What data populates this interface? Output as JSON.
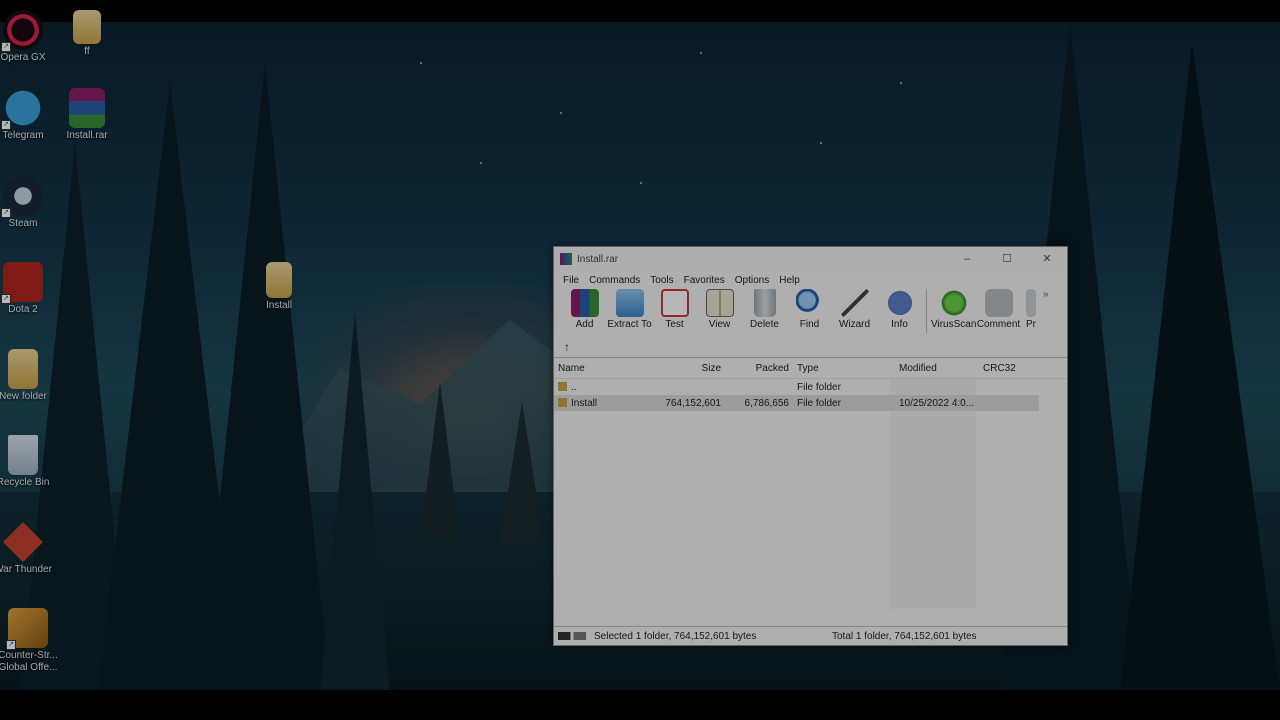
{
  "desktop": {
    "icons": [
      {
        "label": "Opera GX",
        "icon": "opera-gx-icon"
      },
      {
        "label": "ff",
        "icon": "folder-icon"
      },
      {
        "label": "Telegram",
        "icon": "telegram-icon"
      },
      {
        "label": "Install.rar",
        "icon": "winrar-archive-icon"
      },
      {
        "label": "Steam",
        "icon": "steam-icon"
      },
      {
        "label": "Install",
        "icon": "folder-icon"
      },
      {
        "label": "Dota 2",
        "icon": "dota2-icon"
      },
      {
        "label": "New folder",
        "icon": "folder-icon"
      },
      {
        "label": "Recycle Bin",
        "icon": "recycle-bin-icon"
      },
      {
        "label": "War Thunder",
        "icon": "war-thunder-icon"
      },
      {
        "label": "Counter-Str... Global Offe...",
        "icon": "csgo-icon"
      }
    ]
  },
  "window": {
    "title": "Install.rar",
    "controls": {
      "minimize": "–",
      "maximize": "☐",
      "close": "✕"
    },
    "menu": [
      "File",
      "Commands",
      "Tools",
      "Favorites",
      "Options",
      "Help"
    ],
    "toolbar": [
      {
        "label": "Add",
        "icon": "add-icon"
      },
      {
        "label": "Extract To",
        "icon": "extract-to-icon"
      },
      {
        "label": "Test",
        "icon": "test-icon"
      },
      {
        "label": "View",
        "icon": "view-icon"
      },
      {
        "label": "Delete",
        "icon": "delete-icon"
      },
      {
        "label": "Find",
        "icon": "find-icon"
      },
      {
        "label": "Wizard",
        "icon": "wizard-icon"
      },
      {
        "label": "Info",
        "icon": "info-icon"
      },
      {
        "label": "VirusScan",
        "icon": "virusscan-icon"
      },
      {
        "label": "Comment",
        "icon": "comment-icon"
      },
      {
        "label": "Pr",
        "icon": "protect-icon"
      }
    ],
    "toolbar_more": "»",
    "up_arrow": "↑",
    "columns": {
      "name": "Name",
      "size": "Size",
      "packed": "Packed",
      "type": "Type",
      "modified": "Modified",
      "crc": "CRC32"
    },
    "rows": [
      {
        "name": "..",
        "size": "",
        "packed": "",
        "type": "File folder",
        "modified": "",
        "crc": ""
      },
      {
        "name": "Install",
        "size": "764,152,601",
        "packed": "6,786,656",
        "type": "File folder",
        "modified": "10/25/2022 4:0...",
        "crc": ""
      }
    ],
    "status": {
      "left": "Selected 1 folder, 764,152,601 bytes",
      "right": "Total 1 folder, 764,152,601 bytes"
    }
  },
  "colors": {
    "winrar_icon": "#8b1f6a",
    "folder": "#c9a34a",
    "selection": "#d9d9d9"
  }
}
